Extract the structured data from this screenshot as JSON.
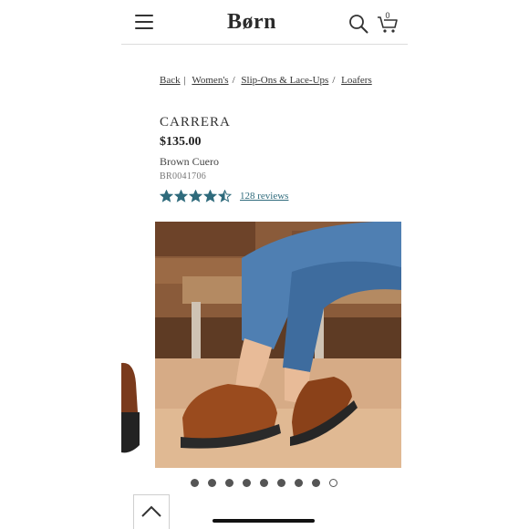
{
  "header": {
    "logo": "Børn",
    "cart_count": "0",
    "icons": [
      "menu-icon",
      "search-icon",
      "cart-icon"
    ]
  },
  "breadcrumb": {
    "back": "Back",
    "items": [
      "Women's",
      "Slip-Ons & Lace-Ups",
      "Loafers"
    ]
  },
  "product": {
    "name": "CARRERA",
    "price": "$135.00",
    "color": "Brown Cuero",
    "sku": "BR0041706",
    "rating": 4.5,
    "rating_max": 5,
    "reviews": "128 reviews"
  },
  "gallery": {
    "image_count": 9,
    "active_index": 8
  },
  "colors": {
    "star": "#2f6b7c",
    "text": "#333333",
    "link": "#2f6b7c"
  }
}
